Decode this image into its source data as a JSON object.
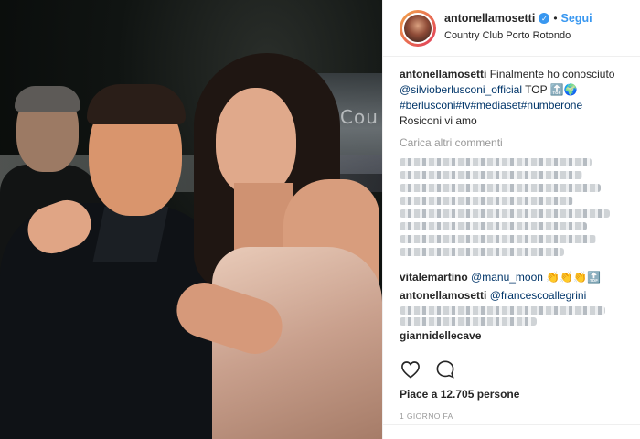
{
  "header": {
    "username": "antonellamosetti",
    "separator": "•",
    "follow_label": "Segui",
    "location": "Country Club Porto Rotondo"
  },
  "photo": {
    "background_sign": "Cou"
  },
  "caption": {
    "username": "antonellamosetti",
    "text": "Finalmente ho conosciuto",
    "mention": "@silvioberlusconi_official",
    "suffix": "TOP 🔝🌍",
    "hashtags": "#berlusconi#tv#mediaset#numberone",
    "last_line": "Rosiconi vi amo"
  },
  "load_more_label": "Carica altri commenti",
  "comments": [
    {
      "username": "vitalemartino",
      "mention": "@manu_moon",
      "text": "👏👏👏🔝"
    },
    {
      "username": "antonellamosetti",
      "mention": "@francescoallegrini",
      "text": ""
    },
    {
      "username": "giannidellecave",
      "mention": "",
      "text": ""
    }
  ],
  "likes_text": "Piace a 12.705 persone",
  "timestamp": "1 GIORNO FA",
  "icons": {
    "like": "heart-icon",
    "comment": "comment-bubble-icon",
    "verified": "verified-badge-icon"
  },
  "colors": {
    "link": "#003569",
    "follow": "#3897f0",
    "verified": "#3897f0",
    "muted": "#999999"
  }
}
